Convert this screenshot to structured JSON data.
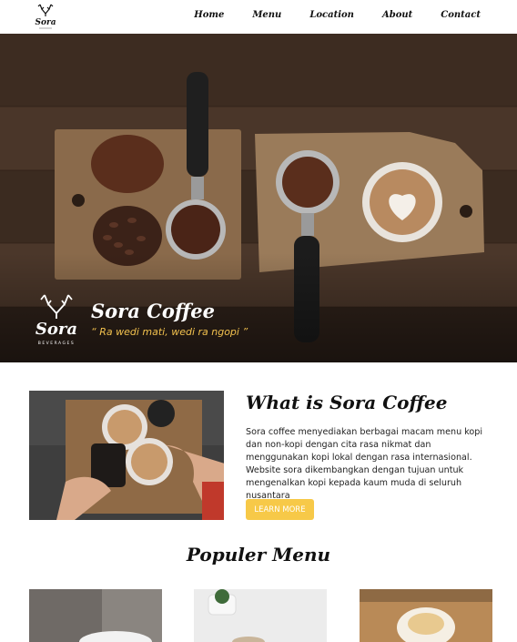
{
  "nav": {
    "logo_text": "Sora",
    "links": [
      "Home",
      "Menu",
      "Location",
      "About",
      "Contact"
    ]
  },
  "hero": {
    "logo_text": "Sora",
    "logo_sub": "BEVERAGES",
    "title": "Sora Coffee",
    "tagline": "“ Ra wedi mati, wedi ra ngopi ”"
  },
  "about": {
    "title": "What is Sora Coffee",
    "text": "Sora coffee menyediakan berbagai macam menu kopi dan non-kopi dengan cita rasa nikmat dan menggunakan kopi lokal dengan rasa internasional. Website sora dikembangkan dengan tujuan untuk mengenalkan kopi kepada kaum muda di seluruh nusantara",
    "button_label": "LEARN MORE"
  },
  "menu": {
    "title": "Populer Menu"
  },
  "colors": {
    "accent": "#f7c948",
    "tagline": "#f2c14e"
  }
}
